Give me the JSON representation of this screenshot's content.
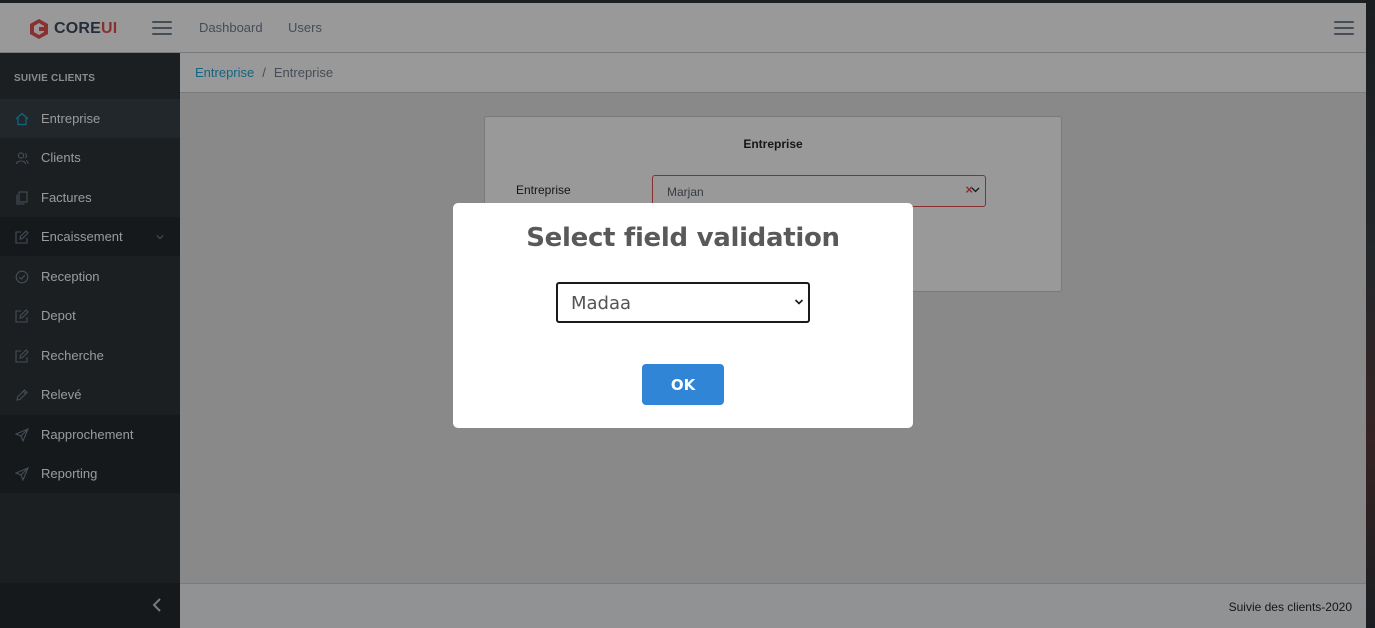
{
  "brand": {
    "name_main": "CORE",
    "name_accent": "UI"
  },
  "header": {
    "nav": [
      "Dashboard",
      "Users"
    ]
  },
  "sidebar": {
    "section_title": "SUIVIE CLIENTS",
    "items": [
      {
        "label": "Entreprise",
        "icon": "home-icon",
        "active": true
      },
      {
        "label": "Clients",
        "icon": "users-icon"
      },
      {
        "label": "Factures",
        "icon": "copy-icon"
      },
      {
        "label": "Encaissement",
        "icon": "edit-icon",
        "has_submenu": true
      },
      {
        "label": "Reception",
        "icon": "check-circle-icon"
      },
      {
        "label": "Depot",
        "icon": "edit-icon"
      },
      {
        "label": "Recherche",
        "icon": "edit-icon"
      },
      {
        "label": "Relevé",
        "icon": "pencil-icon"
      },
      {
        "label": "Rapprochement",
        "icon": "send-icon"
      },
      {
        "label": "Reporting",
        "icon": "send-icon"
      }
    ]
  },
  "breadcrumb": {
    "link": "Entreprise",
    "separator": "/",
    "current": "Entreprise"
  },
  "card": {
    "title": "Entreprise",
    "field_label": "Entreprise",
    "select_value": "Marjan"
  },
  "footer": {
    "text": "Suivie des clients-2020"
  },
  "modal": {
    "title": "Select field validation",
    "select_value": "Madaa",
    "ok_label": "OK"
  },
  "colors": {
    "accent": "#3085d6",
    "brand_red": "#e55353",
    "sidebar_bg": "#2f353a"
  }
}
